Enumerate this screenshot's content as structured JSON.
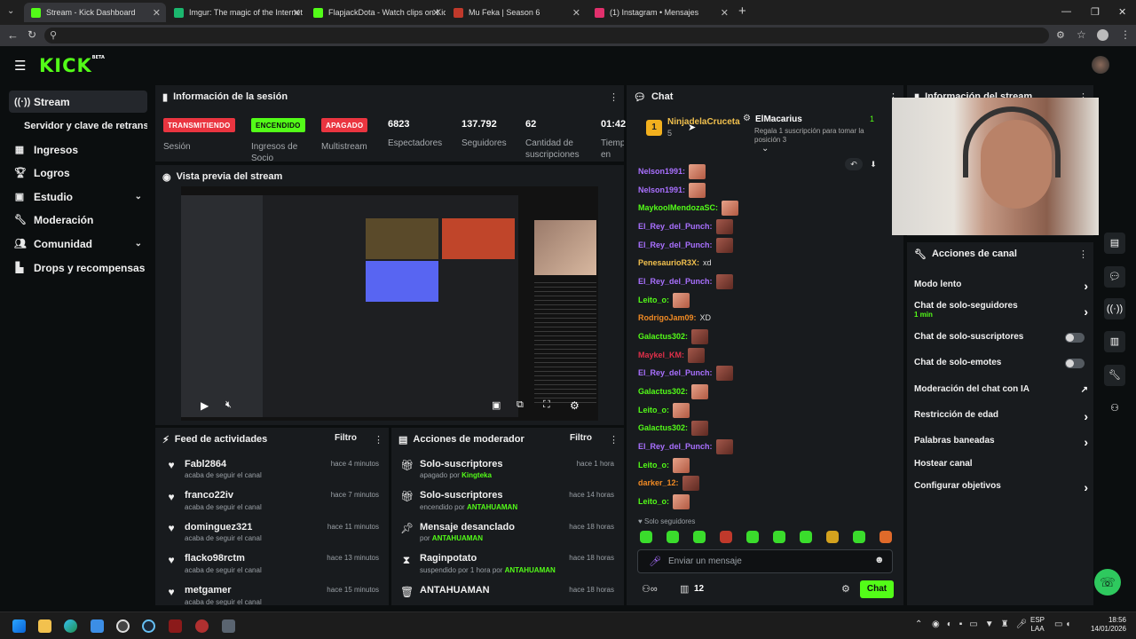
{
  "browser": {
    "tabs": [
      {
        "title": "Stream - Kick Dashboard",
        "color": "#53fc18"
      },
      {
        "title": "Imgur: The magic of the Internet",
        "color": "#1bb76e"
      },
      {
        "title": "FlapjackDota - Watch clips on Kick",
        "color": "#53fc18"
      },
      {
        "title": "Mu Feka | Season 6",
        "color": "#c0392b"
      },
      {
        "title": "(1) Instagram • Mensajes",
        "color": "#e1306c"
      }
    ],
    "new_tab": "+"
  },
  "sidebar": {
    "items": [
      {
        "label": "Stream",
        "icon": "stream-icon"
      },
      {
        "label": "Servidor y clave de retransmisión"
      },
      {
        "label": "Ingresos",
        "icon": "chart-icon"
      },
      {
        "label": "Logros",
        "icon": "trophy-icon"
      },
      {
        "label": "Estudio",
        "icon": "studio-icon"
      },
      {
        "label": "Moderación",
        "icon": "wrench-icon"
      },
      {
        "label": "Comunidad",
        "icon": "community-icon"
      },
      {
        "label": "Drops y recompensas",
        "icon": "drops-icon"
      }
    ]
  },
  "session": {
    "title": "Información de la sesión",
    "badges": [
      {
        "text": "TRANSMITIENDO",
        "label": "Sesión",
        "bg": "#ea3540",
        "fg": "#ffffff"
      },
      {
        "text": "ENCENDIDO",
        "label": "Ingresos de Socio",
        "bg": "#53fc18",
        "fg": "#0b0e0f"
      },
      {
        "text": "APAGADO",
        "label": "Multistream",
        "bg": "#ea3540",
        "fg": "#ffffff"
      }
    ],
    "stats": [
      {
        "value": "6823",
        "label": "Espectadores"
      },
      {
        "value": "137.792",
        "label": "Seguidores"
      },
      {
        "value": "62",
        "label": "Cantidad de suscripciones"
      },
      {
        "value": "01:42",
        "label": "Tiempo en vivo"
      }
    ]
  },
  "preview": {
    "title": "Vista previa del stream"
  },
  "feed": {
    "title": "Feed de actividades",
    "filter": "Filtro",
    "items": [
      {
        "name": "Fabl2864",
        "sub": "acaba de seguir el canal",
        "time": "hace 4 minutos"
      },
      {
        "name": "franco22iv",
        "sub": "acaba de seguir el canal",
        "time": "hace 7 minutos"
      },
      {
        "name": "dominguez321",
        "sub": "acaba de seguir el canal",
        "time": "hace 11 minutos"
      },
      {
        "name": "flacko98rctm",
        "sub": "acaba de seguir el canal",
        "time": "hace 13 minutos"
      },
      {
        "name": "metgamer",
        "sub": "acaba de seguir el canal",
        "time": "hace 15 minutos"
      }
    ]
  },
  "modactions": {
    "title": "Acciones de moderador",
    "filter": "Filtro",
    "items": [
      {
        "name": "Solo-suscriptores",
        "sub_a": "apagado por ",
        "sub_b": "Kingteka",
        "time": "hace 1 hora"
      },
      {
        "name": "Solo-suscriptores",
        "sub_a": "encendido por ",
        "sub_b": "ANTAHUAMAN",
        "time": "hace 14 horas"
      },
      {
        "name": "Mensaje desanclado",
        "sub_a": "por ",
        "sub_b": "ANTAHUAMAN",
        "time": "hace 18 horas"
      },
      {
        "name": "Raginpotato",
        "sub_a": "suspendido por 1 hora por ",
        "sub_b": "ANTAHUAMAN",
        "time": "hace 18 horas"
      },
      {
        "name": "ANTAHUAMAN",
        "sub_a": "",
        "sub_b": "",
        "time": "hace 18 horas"
      }
    ]
  },
  "chat": {
    "title": "Chat",
    "pinned": {
      "top_user": "NinjadelaCruceta",
      "top_count": "5",
      "gifter": "ElMacarius",
      "gift_text": "Regala 1 suscripción para tomar la posición 3",
      "gift_count": "1",
      "rank": "1"
    },
    "messages": [
      {
        "user": "Nelson1991:",
        "color": "#a970ff",
        "text": "",
        "emote": "emote"
      },
      {
        "user": "Nelson1991:",
        "color": "#a970ff",
        "text": "",
        "emote": "emote"
      },
      {
        "user": "MaykoolMendozaSC:",
        "color": "#53fc18",
        "text": "",
        "emote": "emote"
      },
      {
        "user": "El_Rey_del_Punch:",
        "color": "#a970ff",
        "text": "",
        "emote": "dark"
      },
      {
        "user": "El_Rey_del_Punch:",
        "color": "#a970ff",
        "text": "",
        "emote": "dark"
      },
      {
        "user": "PenesaurioR3X:",
        "color": "#f2c14e",
        "text": "xd",
        "emote": ""
      },
      {
        "user": "El_Rey_del_Punch:",
        "color": "#a970ff",
        "text": "",
        "emote": "dark"
      },
      {
        "user": "Leito_o:",
        "color": "#53fc18",
        "text": "",
        "emote": "emote"
      },
      {
        "user": "RodrigoJam09:",
        "color": "#f08a24",
        "text": "XD",
        "emote": ""
      },
      {
        "user": "Galactus302:",
        "color": "#53fc18",
        "text": "",
        "emote": "dark"
      },
      {
        "user": "Maykel_KM:",
        "color": "#e0304a",
        "text": "",
        "emote": "dark"
      },
      {
        "user": "El_Rey_del_Punch:",
        "color": "#a970ff",
        "text": "",
        "emote": "dark"
      },
      {
        "user": "Galactus302:",
        "color": "#53fc18",
        "text": "",
        "emote": "emote"
      },
      {
        "user": "Leito_o:",
        "color": "#53fc18",
        "text": "",
        "emote": "emote"
      },
      {
        "user": "Galactus302:",
        "color": "#53fc18",
        "text": "",
        "emote": "dark"
      },
      {
        "user": "El_Rey_del_Punch:",
        "color": "#a970ff",
        "text": "",
        "emote": "dark"
      },
      {
        "user": "Leito_o:",
        "color": "#53fc18",
        "text": "",
        "emote": "emote"
      },
      {
        "user": "darker_12:",
        "color": "#f08a24",
        "text": "",
        "emote": "dark"
      },
      {
        "user": "Leito_o:",
        "color": "#53fc18",
        "text": "",
        "emote": "emote"
      }
    ],
    "followers_only": "Solo seguidores",
    "input_placeholder": "Enviar un mensaje",
    "viewers_count": "12",
    "send_label": "Chat"
  },
  "stream_info": {
    "title": "Información del stream"
  },
  "channel_actions": {
    "title": "Acciones de canal",
    "items": [
      {
        "label": "Modo lento",
        "sub": "",
        "control": "arrow"
      },
      {
        "label": "Chat de solo-seguidores",
        "sub": "1 min",
        "control": "arrow"
      },
      {
        "label": "Chat de solo-suscriptores",
        "sub": "",
        "control": "toggle"
      },
      {
        "label": "Chat de solo-emotes",
        "sub": "",
        "control": "toggle"
      },
      {
        "label": "Moderación del chat con IA",
        "sub": "",
        "control": "external"
      },
      {
        "label": "Restricción de edad",
        "sub": "",
        "control": "arrow"
      },
      {
        "label": "Palabras baneadas",
        "sub": "",
        "control": "arrow"
      },
      {
        "label": "Hostear canal",
        "sub": "",
        "control": "none"
      },
      {
        "label": "Configurar objetivos",
        "sub": "",
        "control": "arrow"
      }
    ]
  },
  "taskbar": {
    "lang": "ESP",
    "lang2": "LAA",
    "time": "18:56",
    "date": "14/01/2026"
  },
  "brand": {
    "logo": "KICK",
    "beta": "BETA",
    "accent": "#53fc18"
  }
}
